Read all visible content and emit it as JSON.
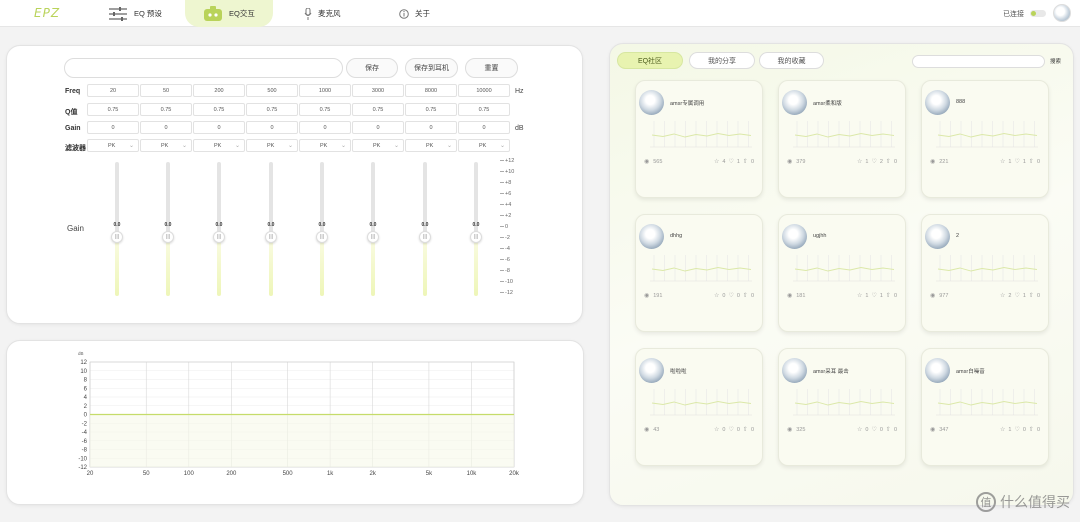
{
  "app": {
    "logo": "EPZ",
    "status": "已连接"
  },
  "nav": [
    {
      "label": "EQ 预设",
      "icon": "sliders-icon"
    },
    {
      "label": "EQ交互",
      "icon": "robot-icon",
      "active": true
    },
    {
      "label": "麦克风",
      "icon": "microphone-icon"
    },
    {
      "label": "关于",
      "icon": "info-icon"
    }
  ],
  "eq": {
    "name_placeholder": "",
    "buttons": {
      "save": "保存",
      "save_device": "保存到耳机",
      "reset": "重置"
    },
    "rows": {
      "freq": "Freq",
      "q": "Q值",
      "gain": "Gain",
      "filter": "滤波器"
    },
    "units": {
      "freq": "Hz",
      "gain": "dB"
    },
    "bands": [
      {
        "freq": "20",
        "q": "0.75",
        "gain": "0",
        "filter": "PK"
      },
      {
        "freq": "50",
        "q": "0.75",
        "gain": "0",
        "filter": "PK"
      },
      {
        "freq": "200",
        "q": "0.75",
        "gain": "0",
        "filter": "PK"
      },
      {
        "freq": "500",
        "q": "0.75",
        "gain": "0",
        "filter": "PK"
      },
      {
        "freq": "1000",
        "q": "0.75",
        "gain": "0",
        "filter": "PK"
      },
      {
        "freq": "3000",
        "q": "0.75",
        "gain": "0",
        "filter": "PK"
      },
      {
        "freq": "8000",
        "q": "0.75",
        "gain": "0",
        "filter": "PK"
      },
      {
        "freq": "10000",
        "q": "0.75",
        "gain": "0",
        "filter": "PK"
      }
    ],
    "slider_label": "Gain",
    "slider_value": "0.0",
    "scale": [
      "+12",
      "+10",
      "+8",
      "+6",
      "+4",
      "+2",
      "0",
      "-2",
      "-4",
      "-6",
      "-8",
      "-10",
      "-12"
    ]
  },
  "graph": {
    "unit_label": "dB",
    "y_ticks": [
      "12",
      "10",
      "8",
      "6",
      "4",
      "2",
      "0",
      "-2",
      "-4",
      "-6",
      "-8",
      "-10",
      "-12"
    ],
    "x_ticks": [
      "20",
      "50",
      "100",
      "200",
      "500",
      "1k",
      "2k",
      "5k",
      "10k",
      "20k"
    ]
  },
  "community": {
    "tabs": [
      {
        "label": "EQ社区",
        "active": true
      },
      {
        "label": "我的分享"
      },
      {
        "label": "我的收藏"
      }
    ],
    "search_placeholder": "",
    "search_button": "搜索",
    "cards": [
      {
        "name": "amsr专属调用",
        "views": "565",
        "stars": "4",
        "likes": "1",
        "shares": "0"
      },
      {
        "name": "amsr柔和版",
        "views": "379",
        "stars": "1",
        "likes": "2",
        "shares": "0"
      },
      {
        "name": "888",
        "views": "221",
        "stars": "1",
        "likes": "1",
        "shares": "0"
      },
      {
        "name": "dhhg",
        "views": "191",
        "stars": "0",
        "likes": "0",
        "shares": "0"
      },
      {
        "name": "ugjhh",
        "views": "181",
        "stars": "1",
        "likes": "1",
        "shares": "0"
      },
      {
        "name": "2",
        "views": "977",
        "stars": "2",
        "likes": "1",
        "shares": "0"
      },
      {
        "name": "啦啦啦",
        "views": "43",
        "stars": "0",
        "likes": "0",
        "shares": "0"
      },
      {
        "name": "amsr采耳 最击",
        "views": "325",
        "stars": "0",
        "likes": "0",
        "shares": "0"
      },
      {
        "name": "amsr白噪音",
        "views": "347",
        "stars": "1",
        "likes": "0",
        "shares": "0"
      }
    ]
  },
  "watermark": {
    "text": "什么值得买",
    "mark": "值"
  },
  "colors": {
    "accent": "#b9d35a",
    "accent_light": "#eef6d0",
    "curve": "#c5dc6a"
  }
}
